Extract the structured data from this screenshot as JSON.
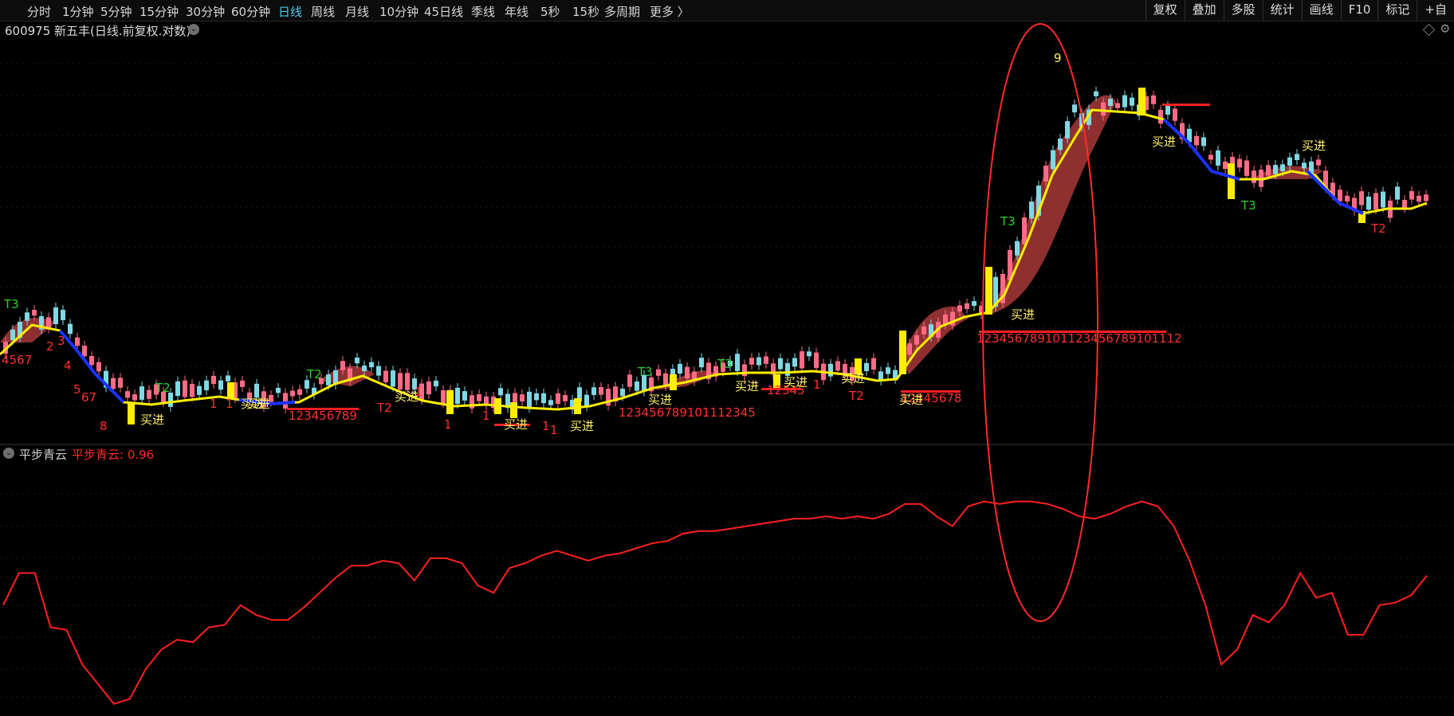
{
  "toolbar": {
    "periods": [
      "分时",
      "1分钟",
      "5分钟",
      "15分钟",
      "30分钟",
      "60分钟",
      "日线",
      "周线",
      "月线",
      "10分钟",
      "45日线",
      "季线",
      "年线",
      "5秒",
      "15秒",
      "多周期",
      "更多 〉"
    ],
    "active": "日线",
    "right_tools": [
      "复权",
      "叠加",
      "多股",
      "统计",
      "画线",
      "F10",
      "标记",
      "+自"
    ]
  },
  "header": {
    "stock": "600975 新五丰(日线.前复权.对数)"
  },
  "indicator": {
    "name": "平步青云",
    "value_label": "平步青云: 0.96"
  },
  "colors": {
    "up": "#ff6b86",
    "down": "#7fd8e3",
    "signal": "#ffee00",
    "line": "#ff2020",
    "blue": "#1a32ff",
    "fill": "#a83838"
  },
  "icons": [
    "chevron-down-icon",
    "diamond-icon",
    "gear-icon"
  ],
  "labels": [
    {
      "t": "T3",
      "c": "#2bd12b"
    },
    {
      "t": "4567",
      "c": "#ff3030"
    },
    {
      "t": "2",
      "c": "#ff3030"
    },
    {
      "t": "3",
      "c": "#ff3030"
    },
    {
      "t": "4",
      "c": "#ff3030"
    },
    {
      "t": "5",
      "c": "#ff3030"
    },
    {
      "t": "67",
      "c": "#ff3030"
    },
    {
      "t": "8",
      "c": "#ff3030"
    },
    {
      "t": "买进",
      "c": "#ffee66"
    },
    {
      "t": "T2",
      "c": "#2bd12b"
    },
    {
      "t": "1",
      "c": "#ff3030"
    },
    {
      "t": "1",
      "c": "#ff3030"
    },
    {
      "t": "买进",
      "c": "#ffee66"
    },
    {
      "t": "T2",
      "c": "#2bd12b"
    },
    {
      "t": "123456789",
      "c": "#ff3030"
    },
    {
      "t": "买进",
      "c": "#ffee66"
    },
    {
      "t": "T2",
      "c": "#ff3030"
    },
    {
      "t": "买进",
      "c": "#ffee66"
    },
    {
      "t": "1",
      "c": "#ff3030"
    },
    {
      "t": "1",
      "c": "#ff3030"
    },
    {
      "t": "1",
      "c": "#ff3030"
    },
    {
      "t": "买进",
      "c": "#ffee66"
    },
    {
      "t": "1",
      "c": "#ff3030"
    },
    {
      "t": "1",
      "c": "#ff3030"
    },
    {
      "t": "买进",
      "c": "#ffee66"
    },
    {
      "t": "T3",
      "c": "#2bd12b"
    },
    {
      "t": "123456789101112345",
      "c": "#ff3030"
    },
    {
      "t": "买进",
      "c": "#ffee66"
    },
    {
      "t": "T3",
      "c": "#2bd12b"
    },
    {
      "t": "买进",
      "c": "#ffee66"
    },
    {
      "t": "12345",
      "c": "#ff3030"
    },
    {
      "t": "买进",
      "c": "#ffee66"
    },
    {
      "t": "1",
      "c": "#ff3030"
    },
    {
      "t": "T2",
      "c": "#ff3030"
    },
    {
      "t": "买进",
      "c": "#ffee66"
    },
    {
      "t": "12345678",
      "c": "#ff3030"
    },
    {
      "t": "买进",
      "c": "#ffee66"
    },
    {
      "t": "T3",
      "c": "#2bd12b"
    },
    {
      "t": "9",
      "c": "#ffee66"
    },
    {
      "t": "123456789101123456789101112",
      "c": "#ff3030"
    },
    {
      "t": "买进",
      "c": "#ffee66"
    },
    {
      "t": "买进",
      "c": "#ffee66"
    },
    {
      "t": "T3",
      "c": "#2bd12b"
    },
    {
      "t": "买进",
      "c": "#ffee66"
    },
    {
      "t": "T2",
      "c": "#ff3030"
    }
  ],
  "indicator_values": [
    0.42,
    0.55,
    0.55,
    0.33,
    0.32,
    0.18,
    0.1,
    0.02,
    0.04,
    0.16,
    0.24,
    0.28,
    0.27,
    0.33,
    0.34,
    0.42,
    0.38,
    0.36,
    0.36,
    0.41,
    0.47,
    0.53,
    0.58,
    0.58,
    0.6,
    0.59,
    0.52,
    0.61,
    0.61,
    0.59,
    0.5,
    0.47,
    0.57,
    0.59,
    0.62,
    0.64,
    0.62,
    0.6,
    0.62,
    0.63,
    0.65,
    0.67,
    0.68,
    0.71,
    0.72,
    0.72,
    0.73,
    0.74,
    0.75,
    0.76,
    0.77,
    0.77,
    0.78,
    0.77,
    0.78,
    0.77,
    0.79,
    0.83,
    0.83,
    0.78,
    0.74,
    0.82,
    0.84,
    0.83,
    0.84,
    0.84,
    0.83,
    0.81,
    0.78,
    0.77,
    0.79,
    0.82,
    0.84,
    0.82,
    0.74,
    0.6,
    0.42,
    0.18,
    0.24,
    0.38,
    0.35,
    0.42,
    0.55,
    0.45,
    0.47,
    0.3,
    0.3,
    0.42,
    0.43,
    0.46,
    0.54
  ]
}
